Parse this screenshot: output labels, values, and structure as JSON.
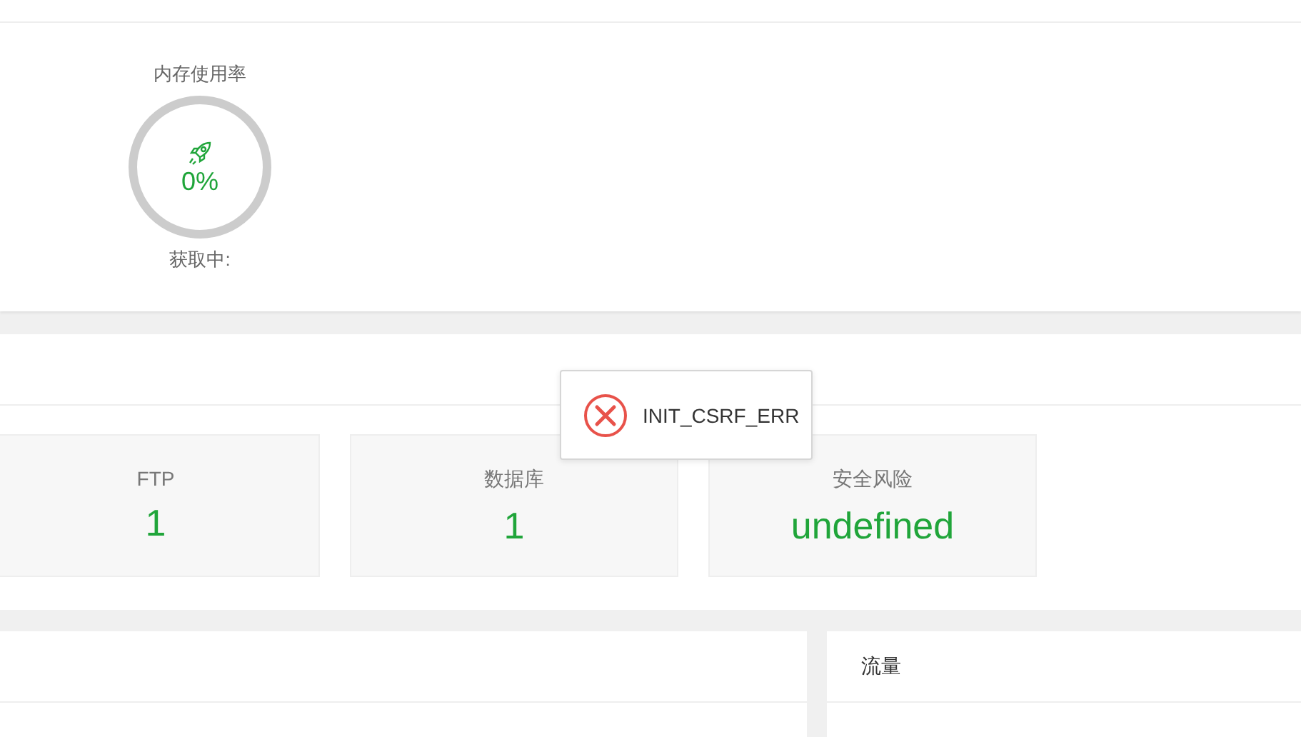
{
  "memory_gauge": {
    "title": "内存使用率",
    "value": "0%",
    "status": "获取中:"
  },
  "stats": [
    {
      "label": "FTP",
      "value": "1"
    },
    {
      "label": "数据库",
      "value": "1"
    },
    {
      "label": "安全风险",
      "value": "undefined"
    }
  ],
  "traffic_panel": {
    "title": "流量"
  },
  "toast": {
    "kind": "error",
    "message": "INIT_CSRF_ERR"
  }
}
